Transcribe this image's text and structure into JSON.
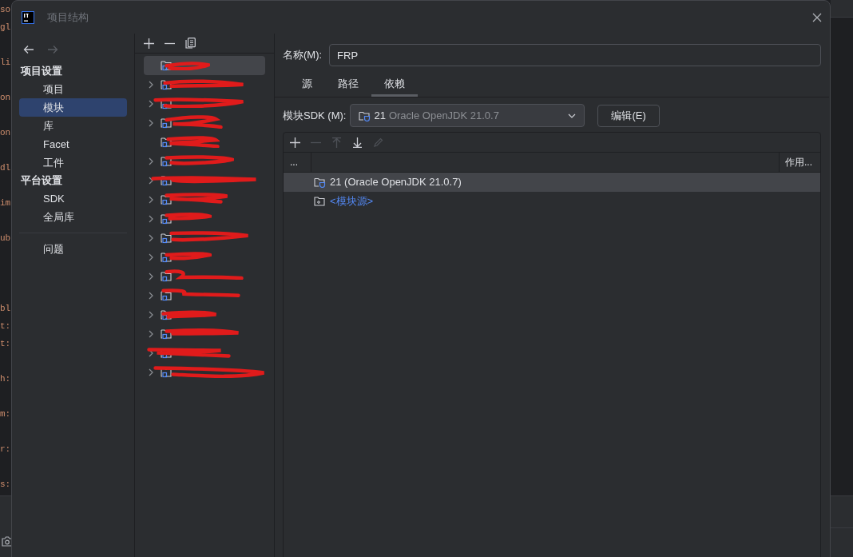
{
  "editor": {
    "lines": [
      {
        "kind": "code",
        "text": "so"
      },
      {
        "kind": "code",
        "text": "gl"
      },
      {
        "kind": "blank"
      },
      {
        "kind": "code",
        "text": "li"
      },
      {
        "kind": "blank"
      },
      {
        "kind": "code",
        "text": "on"
      },
      {
        "kind": "blank"
      },
      {
        "kind": "code",
        "text": "on"
      },
      {
        "kind": "blank"
      },
      {
        "kind": "code",
        "text": "dl"
      },
      {
        "kind": "blank"
      },
      {
        "kind": "code",
        "text": "im"
      },
      {
        "kind": "blank"
      },
      {
        "kind": "code",
        "text": "ub"
      },
      {
        "kind": "blank"
      },
      {
        "kind": "blank"
      },
      {
        "kind": "blank"
      },
      {
        "kind": "code",
        "text": "bl"
      },
      {
        "kind": "code",
        "text": "t:"
      },
      {
        "kind": "code",
        "text": "t:"
      },
      {
        "kind": "blank"
      },
      {
        "kind": "code",
        "text": "h:"
      },
      {
        "kind": "blank"
      },
      {
        "kind": "code",
        "text": "m:"
      },
      {
        "kind": "blank"
      },
      {
        "kind": "code",
        "text": "r:"
      },
      {
        "kind": "blank"
      },
      {
        "kind": "code",
        "text": "s:"
      }
    ]
  },
  "window": {
    "title": "项目结构"
  },
  "nav": {
    "back_enabled": true,
    "forward_enabled": false
  },
  "sidebar": {
    "items": [
      {
        "kind": "heading",
        "label": "项目设置"
      },
      {
        "kind": "item",
        "label": "项目",
        "selected": false
      },
      {
        "kind": "item",
        "label": "模块",
        "selected": true
      },
      {
        "kind": "item",
        "label": "库",
        "selected": false
      },
      {
        "kind": "item",
        "label": "Facet",
        "selected": false
      },
      {
        "kind": "item",
        "label": "工件",
        "selected": false
      },
      {
        "kind": "heading",
        "label": "平台设置"
      },
      {
        "kind": "item",
        "label": "SDK",
        "selected": false
      },
      {
        "kind": "item",
        "label": "全局库",
        "selected": false
      },
      {
        "kind": "divider"
      },
      {
        "kind": "item",
        "label": "问题",
        "selected": false
      }
    ]
  },
  "module_tree": {
    "items": [
      {
        "expandable": false,
        "selected": true
      },
      {
        "expandable": true,
        "selected": false
      },
      {
        "expandable": true,
        "selected": false
      },
      {
        "expandable": true,
        "selected": false
      },
      {
        "expandable": false,
        "selected": false
      },
      {
        "expandable": true,
        "selected": false
      },
      {
        "expandable": true,
        "selected": false
      },
      {
        "expandable": true,
        "selected": false
      },
      {
        "expandable": true,
        "selected": false
      },
      {
        "expandable": true,
        "selected": false
      },
      {
        "expandable": true,
        "selected": false
      },
      {
        "expandable": true,
        "selected": false
      },
      {
        "expandable": true,
        "selected": false
      },
      {
        "expandable": true,
        "selected": false
      },
      {
        "expandable": true,
        "selected": false
      },
      {
        "expandable": true,
        "selected": false
      },
      {
        "expandable": true,
        "selected": false
      }
    ]
  },
  "name_field": {
    "label": "名称(M):",
    "value": "FRP"
  },
  "tabs": [
    {
      "label": "源",
      "selected": false
    },
    {
      "label": "路径",
      "selected": false
    },
    {
      "label": "依赖",
      "selected": true
    }
  ],
  "sdk": {
    "label": "模块SDK (M):",
    "version": "21",
    "name": "Oracle OpenJDK 21.0.7",
    "edit_button": "编辑(E)"
  },
  "dependency_toolbar": [
    {
      "kind": "add",
      "disabled": false
    },
    {
      "kind": "remove",
      "disabled": true
    },
    {
      "kind": "up",
      "disabled": true
    },
    {
      "kind": "down",
      "disabled": false
    },
    {
      "kind": "edit",
      "disabled": true
    }
  ],
  "table": {
    "columns": [
      "...",
      "作用..."
    ],
    "rows": [
      {
        "kind": "sdk",
        "text": "21 (Oracle OpenJDK 21.0.7)",
        "selected": true
      },
      {
        "kind": "source",
        "text": "<模块源>",
        "selected": false
      }
    ]
  }
}
